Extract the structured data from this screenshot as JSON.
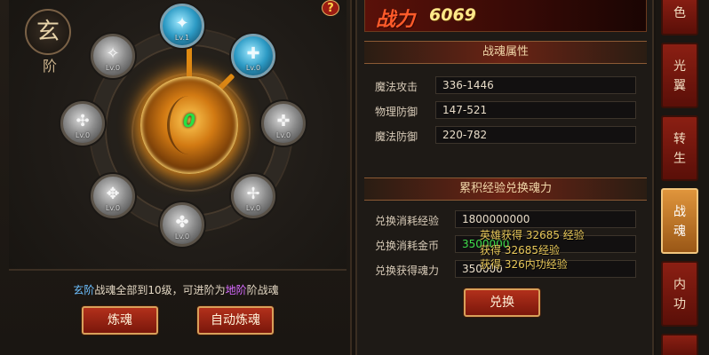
{
  "wheel": {
    "rank_seal": "玄",
    "rank_sub": "阶",
    "help": "?",
    "core_level": "0",
    "nodes": [
      {
        "level": "Lv.1",
        "glyph": "✦",
        "active": true
      },
      {
        "level": "Lv.0",
        "glyph": "✚",
        "active": true
      },
      {
        "level": "Lv.0",
        "glyph": "✜",
        "active": false
      },
      {
        "level": "Lv.0",
        "glyph": "✢",
        "active": false
      },
      {
        "level": "Lv.0",
        "glyph": "✤",
        "active": false
      },
      {
        "level": "Lv.0",
        "glyph": "✥",
        "active": false
      },
      {
        "level": "Lv.0",
        "glyph": "✣",
        "active": false
      },
      {
        "level": "Lv.0",
        "glyph": "✧",
        "active": false
      }
    ]
  },
  "info": {
    "prefix": "玄阶",
    "middle": "战魂全部到10级，可进阶为",
    "target": "地阶",
    "suffix": "阶战魂"
  },
  "buttons": {
    "refine": "炼魂",
    "auto_refine": "自动炼魂",
    "exchange": "兑换"
  },
  "power": {
    "label": "战力",
    "value": "6069"
  },
  "attributes": {
    "title": "战魂属性",
    "rows": [
      {
        "label": "魔法攻击",
        "value": "336-1446"
      },
      {
        "label": "物理防御",
        "value": "147-521"
      },
      {
        "label": "魔法防御",
        "value": "220-782"
      }
    ]
  },
  "exchange": {
    "title": "累积经验兑换魂力",
    "rows": [
      {
        "label": "兑换消耗经验",
        "value": "1800000000"
      },
      {
        "label": "兑换消耗金币",
        "value": "3500000"
      },
      {
        "label": "兑换获得魂力",
        "value": "350000"
      }
    ]
  },
  "overlay_messages": [
    "英雄获得 32685 经验",
    "获得 32685经验",
    "获得 326内功经验"
  ],
  "tabs": [
    {
      "label": "色",
      "active": false
    },
    {
      "label": "光翼",
      "active": false
    },
    {
      "label": "转生",
      "active": false
    },
    {
      "label": "战魂",
      "active": true
    },
    {
      "label": "内功",
      "active": false
    }
  ],
  "colors": {
    "accent_gold": "#e08a12",
    "core_level_green": "#27e043",
    "xuan_blue": "#6ec0ff",
    "di_purple": "#d86bff",
    "power_red": "#ff5b2a"
  }
}
